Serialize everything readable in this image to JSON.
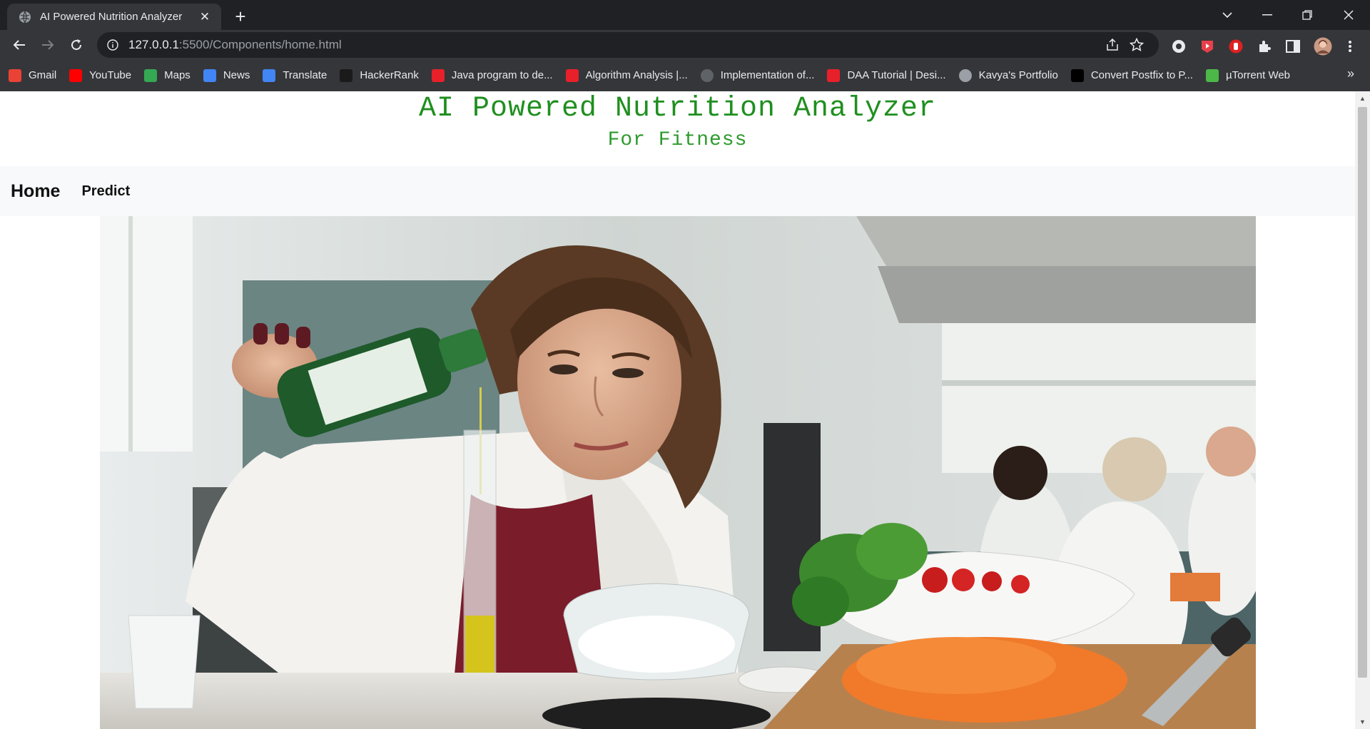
{
  "browser": {
    "tab_title": "AI Powered Nutrition Analyzer",
    "url_host": "127.0.0.1",
    "url_rest": ":5500/Components/home.html",
    "bookmarks": [
      {
        "label": "Gmail",
        "icon": "gmail-icon",
        "color": "#ea4335"
      },
      {
        "label": "YouTube",
        "icon": "youtube-icon",
        "color": "#ff0000"
      },
      {
        "label": "Maps",
        "icon": "maps-icon",
        "color": "#34a853"
      },
      {
        "label": "News",
        "icon": "news-icon",
        "color": "#4285f4"
      },
      {
        "label": "Translate",
        "icon": "translate-icon",
        "color": "#4285f4"
      },
      {
        "label": "HackerRank",
        "icon": "hackerrank-icon",
        "color": "#1a1a1a"
      },
      {
        "label": "Java program to de...",
        "icon": "javatpoint-icon",
        "color": "#e8202a"
      },
      {
        "label": "Algorithm Analysis |...",
        "icon": "bookmark-red-icon",
        "color": "#e8202a"
      },
      {
        "label": "Implementation of...",
        "icon": "github-icon",
        "color": "#5f6368"
      },
      {
        "label": "DAA Tutorial | Desi...",
        "icon": "javatpoint-icon",
        "color": "#e8202a"
      },
      {
        "label": "Kavya's Portfolio",
        "icon": "globe-icon",
        "color": "#9aa0a6"
      },
      {
        "label": "Convert Postfix to P...",
        "icon": "tutorialspoint-icon",
        "color": "#000000"
      },
      {
        "label": "µTorrent Web",
        "icon": "utorrent-icon",
        "color": "#4cb848"
      }
    ]
  },
  "page": {
    "title": "AI Powered Nutrition Analyzer",
    "subtitle": "For Fitness",
    "nav": {
      "brand": "Home",
      "links": [
        "Predict"
      ]
    },
    "hero_image": "woman-pouring-oil-in-kitchen-image"
  },
  "colors": {
    "title_green": "#1f8f1f",
    "navbar_bg": "#f8f9fa"
  }
}
